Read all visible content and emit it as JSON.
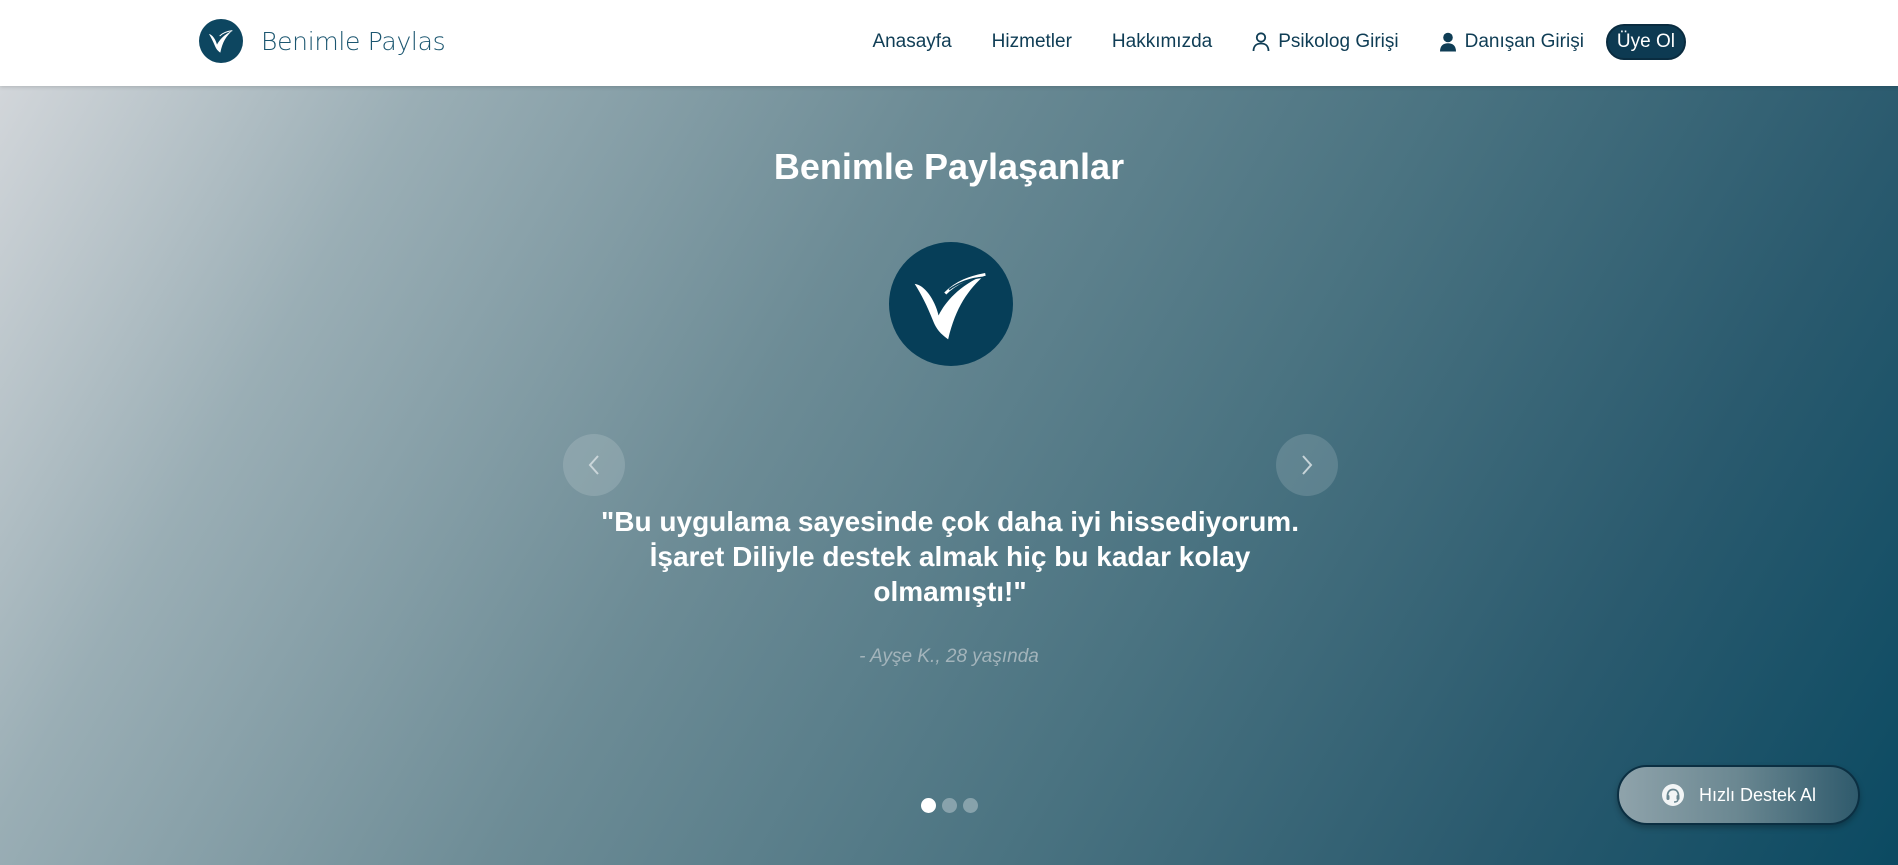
{
  "brand": {
    "name": "Benimle Paylas",
    "logo_icon": "bird-hand-icon"
  },
  "nav": {
    "links": [
      "Anasayfa",
      "Hizmetler",
      "Hakkımızda"
    ],
    "psychologist_login": "Psikolog Girişi",
    "client_login": "Danışan Girişi",
    "signup": "Üye Ol"
  },
  "hero": {
    "title": "Benimle Paylaşanlar",
    "logo_icon": "bird-hand-icon",
    "testimonial": {
      "quote": "\"Bu uygulama sayesinde çok daha iyi hissediyorum. İşaret Diliyle destek almak hiç bu kadar kolay olmamıştı!\"",
      "author": "- Ayşe K., 28 yaşında"
    },
    "carousel": {
      "slides": 3,
      "active": 0,
      "prev_icon": "chevron-left-icon",
      "next_icon": "chevron-right-icon"
    }
  },
  "support_button": {
    "label": "Hızlı Destek Al",
    "icon": "headset-icon"
  },
  "colors": {
    "primary": "#0d3a52",
    "brand_blue": "#0d4660",
    "nav_text": "#0f3d55"
  }
}
